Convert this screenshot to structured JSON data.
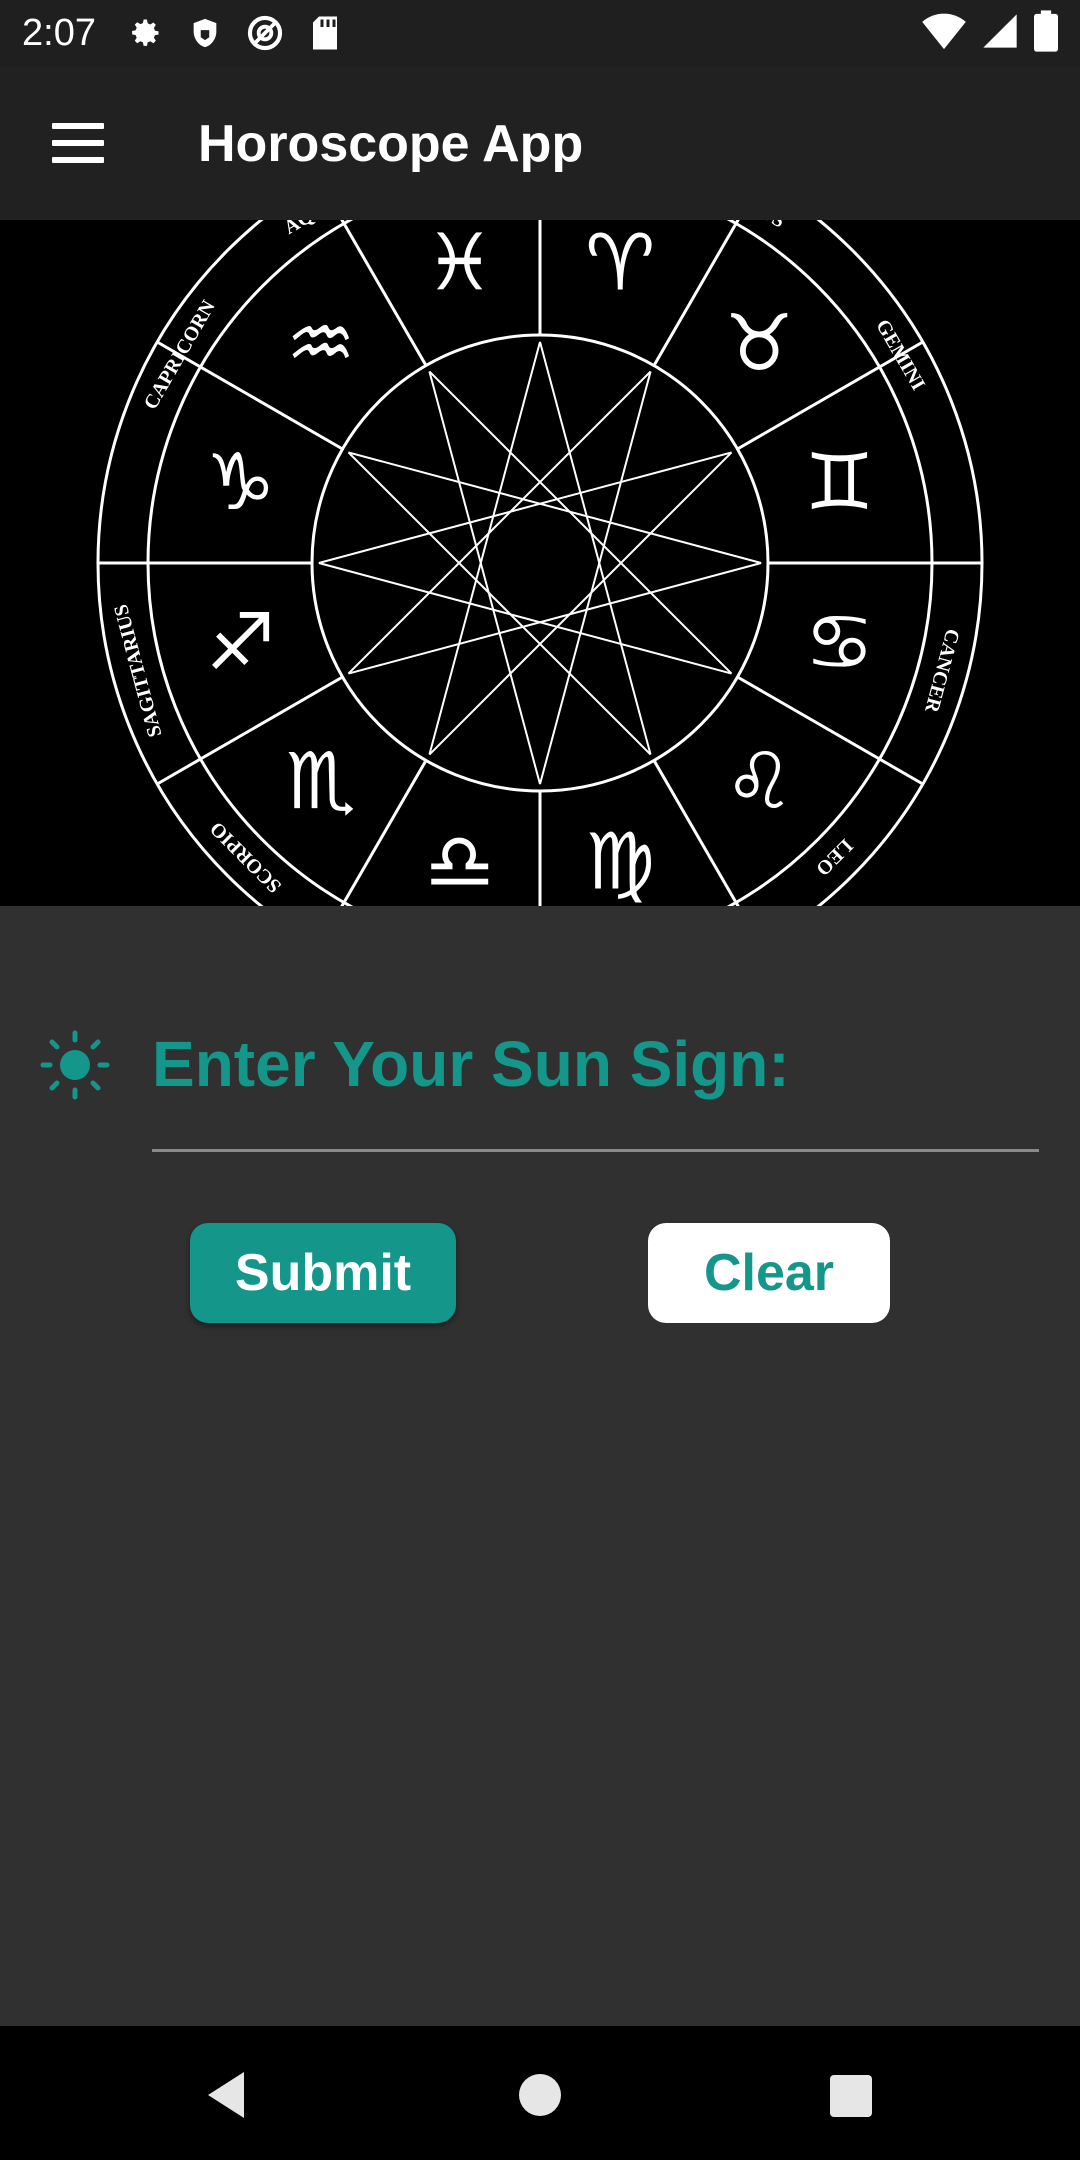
{
  "status_bar": {
    "time": "2:07",
    "left_icons": [
      "gear-icon",
      "shield-icon",
      "at-sign-icon",
      "sd-card-icon"
    ],
    "right_icons": [
      "wifi-icon",
      "signal-icon",
      "battery-icon"
    ]
  },
  "app_bar": {
    "title": "Horoscope App",
    "menu_icon": "menu-icon"
  },
  "hero": {
    "description_icon": "zodiac-wheel-image",
    "sign_names": [
      "AQUARIUS",
      "TAURUS",
      "CAPRICORN",
      "GEMINI",
      "SAGITTARIUS",
      "CANCER",
      "SCORPIO",
      "LEO"
    ]
  },
  "form": {
    "prompt": "Enter Your Sun Sign:",
    "input_value": "",
    "input_placeholder": "",
    "submit_label": "Submit",
    "clear_label": "Clear"
  },
  "colors": {
    "accent": "#14968a",
    "background": "#303030",
    "app_bar": "#212121",
    "status_bar": "#1f1f1f"
  },
  "nav_bar": {
    "icons": [
      "back-icon",
      "home-icon",
      "recents-icon"
    ]
  }
}
